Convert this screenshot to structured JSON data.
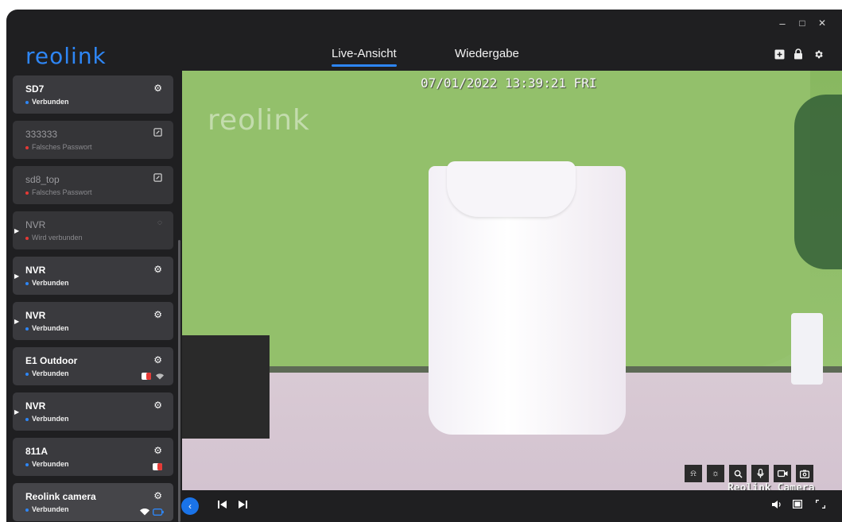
{
  "app": {
    "logo_text": "reolink"
  },
  "window_controls": {
    "minimize": "–",
    "maximize": "□",
    "close": "✕"
  },
  "tabs": [
    {
      "label": "Live-Ansicht",
      "active": true
    },
    {
      "label": "Wiedergabe",
      "active": false
    }
  ],
  "header_icons": [
    "add-device-icon",
    "lock-icon",
    "settings-icon"
  ],
  "devices": [
    {
      "name": "SD7",
      "status": "Verbunden",
      "state": "ok",
      "action_icon": "gear-icon"
    },
    {
      "name": "333333",
      "status": "Falsches Passwort",
      "state": "error",
      "action_icon": "edit-icon"
    },
    {
      "name": "sd8_top",
      "status": "Falsches Passwort",
      "state": "error",
      "action_icon": "edit-icon"
    },
    {
      "name": "NVR",
      "status": "Wird verbunden",
      "state": "connecting",
      "action_icon": "spinner-icon"
    },
    {
      "name": "NVR",
      "status": "Verbunden",
      "state": "ok",
      "action_icon": "gear-icon"
    },
    {
      "name": "NVR",
      "status": "Verbunden",
      "state": "ok",
      "action_icon": "gear-icon"
    },
    {
      "name": "E1 Outdoor",
      "status": "Verbunden",
      "state": "ok",
      "action_icon": "gear-icon"
    },
    {
      "name": "NVR",
      "status": "Verbunden",
      "state": "ok",
      "action_icon": "gear-icon"
    },
    {
      "name": "811A",
      "status": "Verbunden",
      "state": "ok",
      "action_icon": "gear-icon"
    },
    {
      "name": "Reolink camera",
      "status": "Verbunden",
      "state": "ok",
      "action_icon": "gear-icon"
    }
  ],
  "video": {
    "osd_timestamp": "07/01/2022 13:39:21 FRI",
    "watermark": "reolink",
    "camera_label": "Reolink Camera",
    "tools": [
      "siren-icon",
      "spotlight-icon",
      "zoom-icon",
      "microphone-icon",
      "record-icon",
      "snapshot-icon"
    ]
  },
  "colors": {
    "accent": "#2e86f5",
    "connected_dot": "#2e86f5",
    "error_dot": "#e53935"
  }
}
